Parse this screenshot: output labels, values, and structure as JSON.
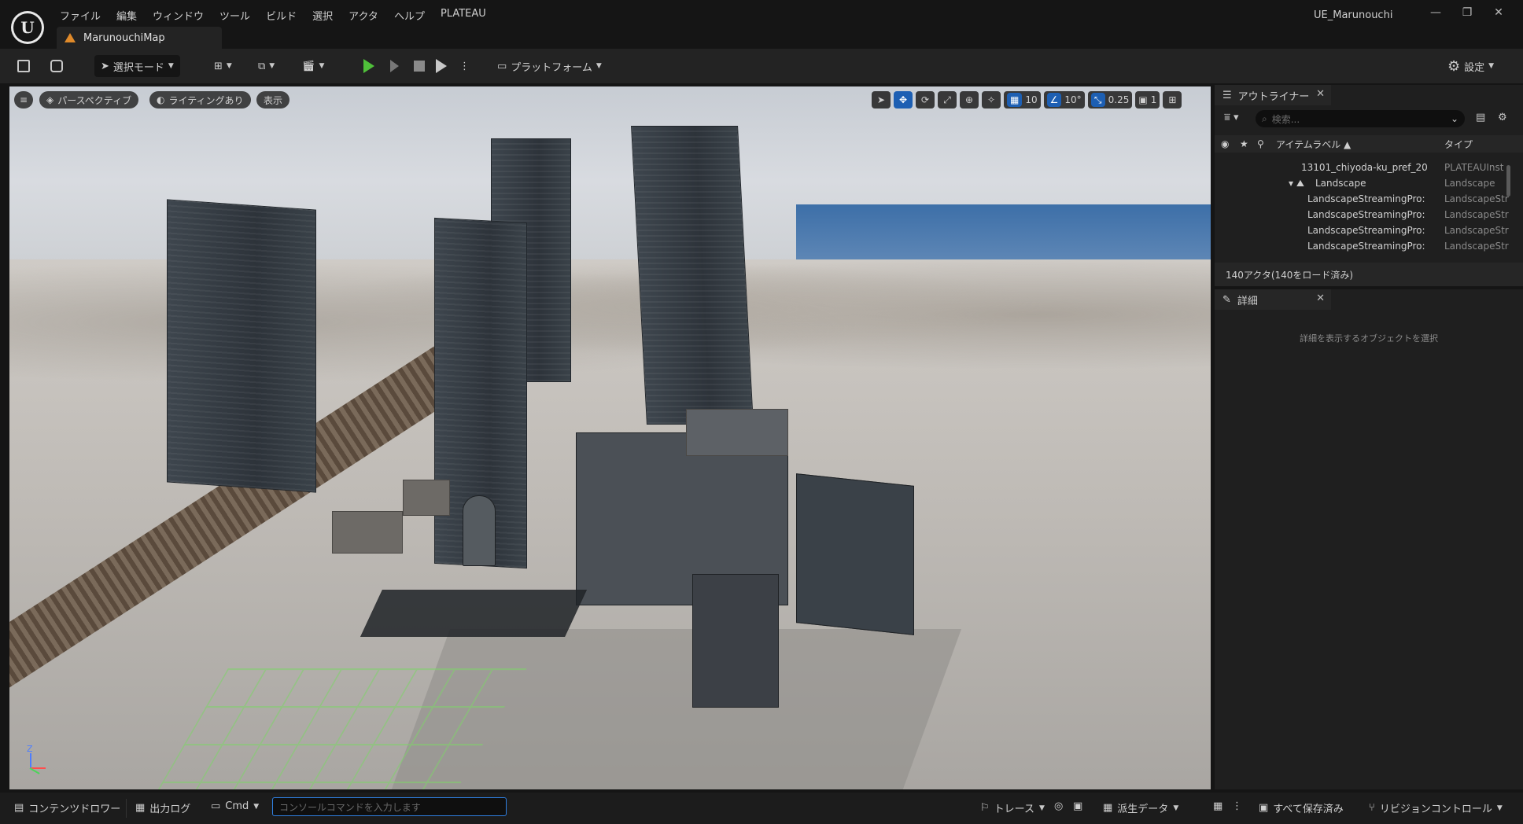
{
  "window": {
    "project_title": "UE_Marunouchi",
    "controls": [
      "—",
      "❐",
      "✕"
    ]
  },
  "menu": [
    "ファイル",
    "編集",
    "ウィンドウ",
    "ツール",
    "ビルド",
    "選択",
    "アクタ",
    "ヘルプ",
    "PLATEAU"
  ],
  "doc_tab": {
    "label": "MarunouchiMap"
  },
  "toolbar": {
    "select_mode": "選択モード",
    "platform": "プラットフォーム",
    "settings": "設定"
  },
  "viewport": {
    "perspective": "パースペクティブ",
    "lighting": "ライティングあり",
    "show": "表示",
    "grid_snap": "10",
    "rotation_snap": "10°",
    "scale_snap": "0.25",
    "camera_speed": "1",
    "axis_z": "Z"
  },
  "outliner": {
    "title": "アウトライナー",
    "search_placeholder": "検索...",
    "columns": {
      "label": "アイテムラベル ▲",
      "type": "タイプ"
    },
    "rows": [
      {
        "label": "13101_chiyoda-ku_pref_20",
        "type": "PLATEAUInst",
        "indent": 1
      },
      {
        "label": "Landscape",
        "type": "Landscape",
        "indent": 0
      },
      {
        "label": "LandscapeStreamingPro:",
        "type": "LandscapeStr",
        "indent": 1
      },
      {
        "label": "LandscapeStreamingPro:",
        "type": "LandscapeStr",
        "indent": 1
      },
      {
        "label": "LandscapeStreamingPro:",
        "type": "LandscapeStr",
        "indent": 1
      },
      {
        "label": "LandscapeStreamingPro:",
        "type": "LandscapeStr",
        "indent": 1
      }
    ],
    "status": "140アクタ(140をロード済み)"
  },
  "details": {
    "title": "詳細",
    "hint": "詳細を表示するオブジェクトを選択"
  },
  "statusbar": {
    "content_drawer": "コンテンツドロワー",
    "output_log": "出力ログ",
    "cmd": "Cmd",
    "console_placeholder": "コンソールコマンドを入力します",
    "trace": "トレース",
    "derived_data": "派生データ",
    "save_all": "すべて保存済み",
    "revision_control": "リビジョンコントロール"
  },
  "colors": {
    "accent_blue": "#1d5fb3",
    "play_green": "#4fbf3a",
    "level_orange": "#e08a2a"
  }
}
